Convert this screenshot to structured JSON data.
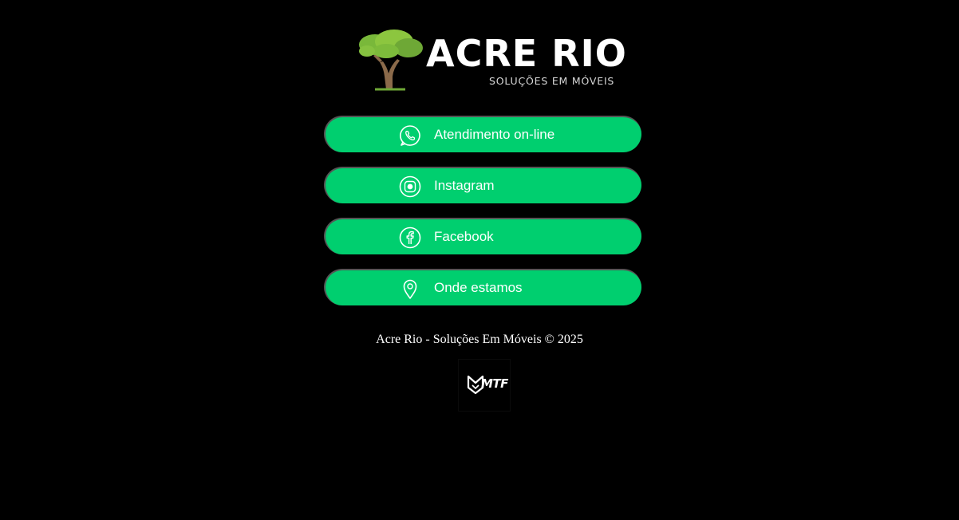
{
  "logo": {
    "title": "ACRE RIO",
    "subtitle": "SOLUÇÕES EM MÓVEIS",
    "icon": "tree-icon"
  },
  "links": [
    {
      "label": "Atendimento on-line",
      "icon": "whatsapp-icon"
    },
    {
      "label": "Instagram",
      "icon": "instagram-icon"
    },
    {
      "label": "Facebook",
      "icon": "facebook-icon"
    },
    {
      "label": "Onde estamos",
      "icon": "map-pin-icon"
    }
  ],
  "footer": {
    "copyright": "Acre Rio - Soluções Em Móveis © 2025"
  },
  "credit": {
    "text": "MTF"
  },
  "colors": {
    "background": "#000000",
    "button": "#00cf6f",
    "text": "#ffffff"
  }
}
